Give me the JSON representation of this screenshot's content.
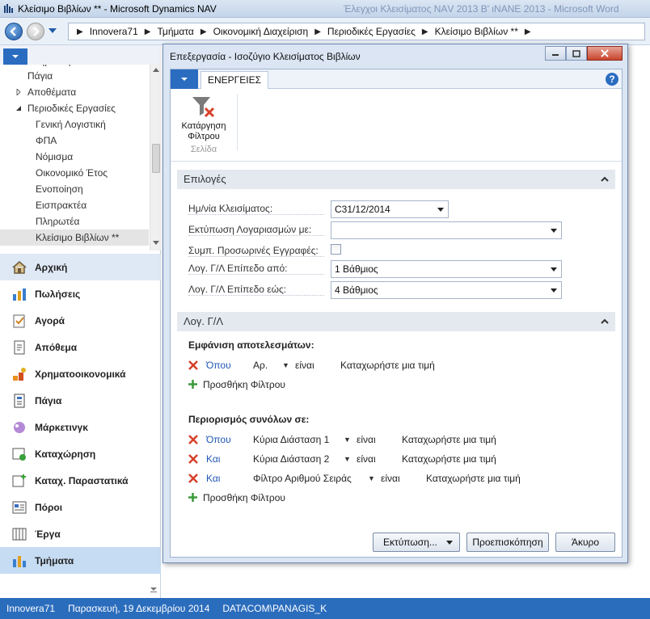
{
  "window": {
    "title": "Κλείσιμο Βιβλίων ** - Microsoft Dynamics NAV",
    "background_title": "Έλεγχοι Κλεισίματος ΝΑV 2013 Β' ιΝΑΝΕ 2013 - Microsoft Word"
  },
  "addressbar": {
    "crumbs": [
      "Innovera71",
      "Τμήματα",
      "Οικονομική Διαχείριση",
      "Περιοδικές Εργασίες",
      "Κλείσιμο Βιβλίων **"
    ]
  },
  "tree": {
    "partial_top": "Πληρωτές",
    "items": [
      {
        "label": "Πάγια",
        "indent": 1,
        "expander": ""
      },
      {
        "label": "Αποθέματα",
        "indent": 1,
        "expander": "collapsed"
      },
      {
        "label": "Περιοδικές Εργασίες",
        "indent": 1,
        "expander": "expanded"
      },
      {
        "label": "Γενική Λογιστική",
        "indent": 2,
        "expander": ""
      },
      {
        "label": "ΦΠΑ",
        "indent": 2,
        "expander": ""
      },
      {
        "label": "Νόμισμα",
        "indent": 2,
        "expander": ""
      },
      {
        "label": "Οικονομικό Έτος",
        "indent": 2,
        "expander": ""
      },
      {
        "label": "Ενοποίηση",
        "indent": 2,
        "expander": ""
      },
      {
        "label": "Εισπρακτέα",
        "indent": 2,
        "expander": ""
      },
      {
        "label": "Πληρωτέα",
        "indent": 2,
        "expander": ""
      },
      {
        "label": "Κλείσιμο Βιβλίων **",
        "indent": 2,
        "expander": "",
        "selected": true
      }
    ]
  },
  "nav": {
    "items": [
      {
        "label": "Αρχική",
        "icon": "home-icon"
      },
      {
        "label": "Πωλήσεις",
        "icon": "sales-icon"
      },
      {
        "label": "Αγορά",
        "icon": "purchase-icon"
      },
      {
        "label": "Απόθεμα",
        "icon": "inventory-icon"
      },
      {
        "label": "Χρηματοοικονομικά",
        "icon": "finance-icon"
      },
      {
        "label": "Πάγια",
        "icon": "fixed-assets-icon"
      },
      {
        "label": "Μάρκετινγκ",
        "icon": "marketing-icon"
      },
      {
        "label": "Καταχώρηση",
        "icon": "posting-icon"
      },
      {
        "label": "Καταχ. Παραστατικά",
        "icon": "posted-documents-icon"
      },
      {
        "label": "Πόροι",
        "icon": "resources-icon"
      },
      {
        "label": "Έργα",
        "icon": "jobs-icon"
      },
      {
        "label": "Τμήματα",
        "icon": "departments-icon",
        "active": true
      }
    ]
  },
  "statusbar": {
    "company": "Innovera71",
    "date": "Παρασκευή, 19 Δεκεμβρίου 2014",
    "user": "DATACOM\\PANAGIS_K"
  },
  "dialog": {
    "title": "Επεξεργασία - Ισοζύγιο Κλεισίματος Βιβλίων",
    "ribbon_tab": "ΕΝΕΡΓΕΙΕΣ",
    "help": "?",
    "clear_filter_label_1": "Κατάργηση",
    "clear_filter_label_2": "Φίλτρου",
    "ribbon_group": "Σελίδα",
    "options": {
      "header": "Επιλογές",
      "closing_date_label": "Ημ/νία Κλεισίματος:",
      "closing_date_value": "C31/12/2014",
      "print_accounts_label": "Εκτύπωση Λογαριασμών με:",
      "print_accounts_value": "",
      "include_temp_label": "Συμπ. Προσωρινές Εγγραφές:",
      "include_temp_checked": false,
      "level_from_label": "Λογ. Γ/Λ Επίπεδο από:",
      "level_from_value": "1 Βάθμιος",
      "level_to_label": "Λογ. Γ/Λ Επίπεδο εώς:",
      "level_to_value": "4 Βάθμιος"
    },
    "gl": {
      "header": "Λογ. Γ/Λ",
      "show_results_title": "Εμφάνιση αποτελεσμάτων:",
      "filter1": {
        "where": "Όπου",
        "field": "Αρ.",
        "op": "είναι",
        "value": "Καταχωρήστε μια τιμή"
      },
      "add_filter": "Προσθήκη Φίλτρου",
      "limit_totals_title": "Περιορισμός συνόλων σε:",
      "totals_filters": [
        {
          "where": "Όπου",
          "field": "Κύρια Διάσταση 1",
          "op": "είναι",
          "value": "Καταχωρήστε μια τιμή"
        },
        {
          "where": "Και",
          "field": "Κύρια Διάσταση 2",
          "op": "είναι",
          "value": "Καταχωρήστε μια τιμή"
        },
        {
          "where": "Και",
          "field": "Φίλτρο Αριθμού Σειράς",
          "op": "είναι",
          "value": "Καταχωρήστε μια τιμή"
        }
      ],
      "add_filter_2": "Προσθήκη Φίλτρου"
    },
    "buttons": {
      "print": "Εκτύπωση...",
      "preview": "Προεπισκόπηση",
      "cancel": "Άκυρο"
    }
  }
}
